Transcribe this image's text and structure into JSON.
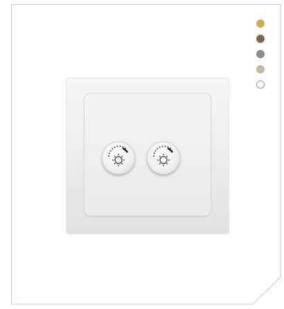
{
  "colors": {
    "card_border": "#c9c9c9",
    "swatch_gold": "#cdae52",
    "swatch_bronze": "#7c6a4a",
    "swatch_gray": "#8c8c8c",
    "swatch_champagne": "#c2b99a",
    "swatch_white": "#ffffff"
  },
  "swatches": [
    {
      "name": "gold",
      "color": "#cdae52"
    },
    {
      "name": "bronze",
      "color": "#7c6a4a"
    },
    {
      "name": "gray",
      "color": "#8c8c8c"
    },
    {
      "name": "champagne",
      "color": "#c2b99a"
    },
    {
      "name": "white",
      "color": "#ffffff"
    }
  ],
  "product": {
    "knobs": [
      {
        "icon": "brightness-icon"
      },
      {
        "icon": "brightness-icon"
      }
    ]
  }
}
